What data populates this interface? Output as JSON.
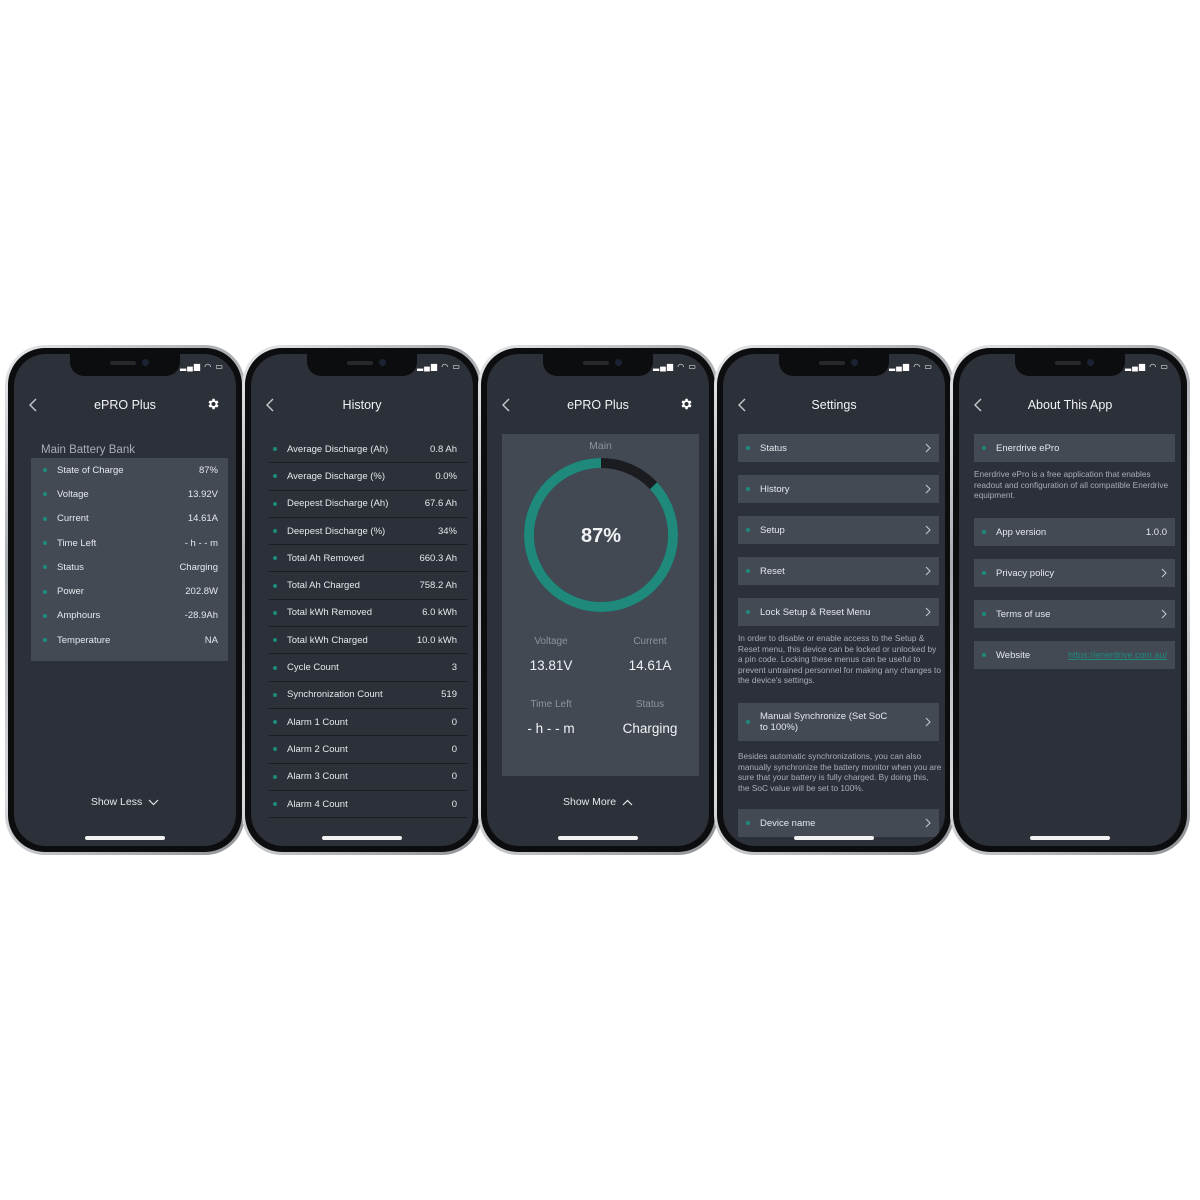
{
  "phone1": {
    "title": "ePRO Plus",
    "section": "Main Battery Bank",
    "rows": [
      {
        "label": "State of Charge",
        "value": "87%"
      },
      {
        "label": "Voltage",
        "value": "13.92V"
      },
      {
        "label": "Current",
        "value": "14.61A"
      },
      {
        "label": "Time Left",
        "value": "- h - - m"
      },
      {
        "label": "Status",
        "value": "Charging"
      },
      {
        "label": "Power",
        "value": "202.8W"
      },
      {
        "label": "Amphours",
        "value": "-28.9Ah"
      },
      {
        "label": "Temperature",
        "value": "NA"
      }
    ],
    "toggle": "Show Less"
  },
  "phone2": {
    "title": "History",
    "rows": [
      {
        "label": "Average Discharge (Ah)",
        "value": "0.8 Ah"
      },
      {
        "label": "Average Discharge (%)",
        "value": "0.0%"
      },
      {
        "label": "Deepest Discharge (Ah)",
        "value": "67.6 Ah"
      },
      {
        "label": "Deepest Discharge (%)",
        "value": "34%"
      },
      {
        "label": "Total Ah Removed",
        "value": "660.3 Ah"
      },
      {
        "label": "Total Ah Charged",
        "value": "758.2 Ah"
      },
      {
        "label": "Total kWh Removed",
        "value": "6.0 kWh"
      },
      {
        "label": "Total kWh Charged",
        "value": "10.0 kWh"
      },
      {
        "label": "Cycle Count",
        "value": "3"
      },
      {
        "label": "Synchronization Count",
        "value": "519"
      },
      {
        "label": "Alarm 1 Count",
        "value": "0"
      },
      {
        "label": "Alarm 2 Count",
        "value": "0"
      },
      {
        "label": "Alarm 3 Count",
        "value": "0"
      },
      {
        "label": "Alarm 4 Count",
        "value": "0"
      }
    ]
  },
  "phone3": {
    "title": "ePRO Plus",
    "card_title": "Main",
    "soc_label": "87%",
    "soc_fraction": 0.87,
    "voltage_label": "Voltage",
    "voltage": "13.81V",
    "current_label": "Current",
    "current": "14.61A",
    "time_left_label": "Time Left",
    "time_left": "- h - - m",
    "status_label": "Status",
    "status": "Charging",
    "toggle": "Show More"
  },
  "phone4": {
    "title": "Settings",
    "items": [
      "Status",
      "History",
      "Setup",
      "Reset",
      "Lock Setup & Reset Menu"
    ],
    "lock_note": "In order to disable or enable access to the Setup & Reset menu, this device can be locked or unlocked by a pin code. Locking these menus can be useful to prevent untrained personnel for making any changes to the device's settings.",
    "sync_item": "Manual Synchronize (Set SoC to 100%)",
    "sync_note": "Besides automatic synchronizations, you can also manually synchronize the battery monitor when you are sure that your battery is fully charged. By doing this, the SoC value will be set to 100%.",
    "device_item": "Device name"
  },
  "phone5": {
    "title": "About This App",
    "app_name": "Enerdrive ePro",
    "description": "Enerdrive ePro is a free application that enables readout and configuration of all compatible Enerdrive equipment.",
    "version_label": "App version",
    "version": "1.0.0",
    "privacy": "Privacy policy",
    "terms": "Terms of use",
    "website_label": "Website",
    "website_url": "https://enerdrive.com.au/"
  },
  "colors": {
    "accent": "#1f8a7c",
    "screen_bg": "#2c3038",
    "card_bg": "#444a54"
  }
}
